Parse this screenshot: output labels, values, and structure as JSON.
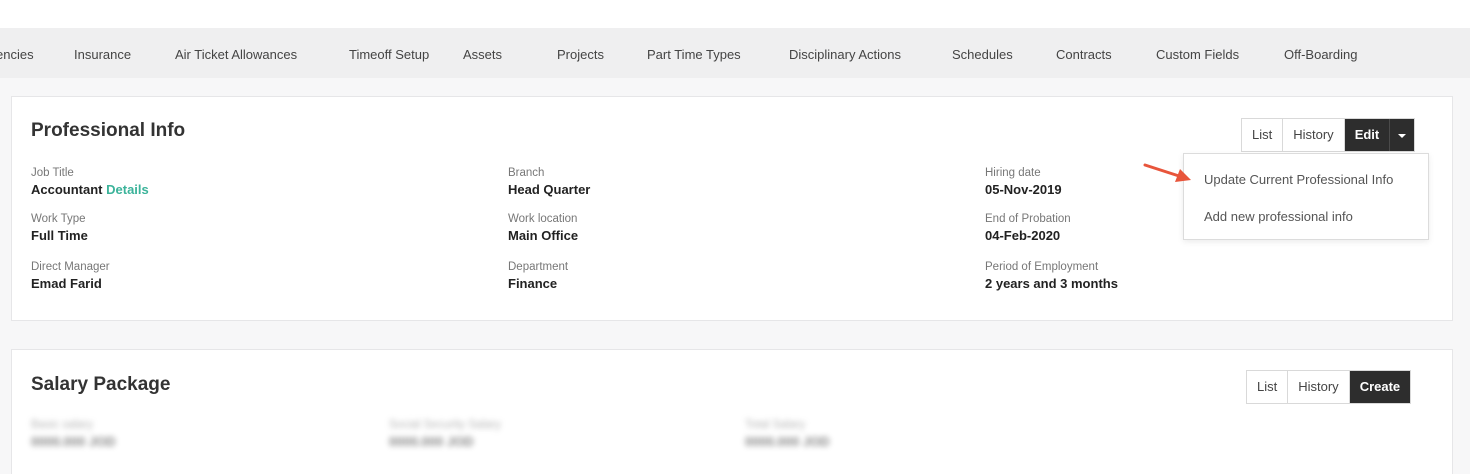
{
  "tabs": [
    "encies",
    "Insurance",
    "Air Ticket Allowances",
    "Timeoff Setup",
    "Assets",
    "Projects",
    "Part Time Types",
    "Disciplinary Actions",
    "Schedules",
    "Contracts",
    "Custom Fields",
    "Off-Boarding"
  ],
  "professional": {
    "title": "Professional Info",
    "buttons": {
      "list": "List",
      "history": "History",
      "edit": "Edit"
    },
    "job_title": {
      "label": "Job Title",
      "value": "Accountant",
      "link": "Details"
    },
    "work_type": {
      "label": "Work Type",
      "value": "Full Time"
    },
    "direct_manager": {
      "label": "Direct Manager",
      "value": "Emad Farid"
    },
    "branch": {
      "label": "Branch",
      "value": "Head Quarter"
    },
    "work_location": {
      "label": "Work location",
      "value": "Main Office"
    },
    "department": {
      "label": "Department",
      "value": "Finance"
    },
    "hiring_date": {
      "label": "Hiring date",
      "value": "05-Nov-2019"
    },
    "end_of_probation": {
      "label": "End of Probation",
      "value": "04-Feb-2020"
    },
    "period_of_employment": {
      "label": "Period of Employment",
      "value": "2 years and 3 months"
    }
  },
  "edit_menu": {
    "items": [
      "Update Current Professional Info",
      "Add new professional info"
    ]
  },
  "salary": {
    "title": "Salary Package",
    "buttons": {
      "list": "List",
      "history": "History",
      "create": "Create"
    },
    "basic": {
      "label": "Basic salary",
      "value": "0000.000 JOD"
    },
    "social": {
      "label": "Social Security Salary",
      "value": "0000.000 JOD"
    },
    "total": {
      "label": "Total Salary",
      "value": "0000.000 JOD"
    }
  },
  "colors": {
    "accent_link": "#3bb39a",
    "dark_button": "#2d2d2d",
    "arrow": "#e8553b"
  }
}
